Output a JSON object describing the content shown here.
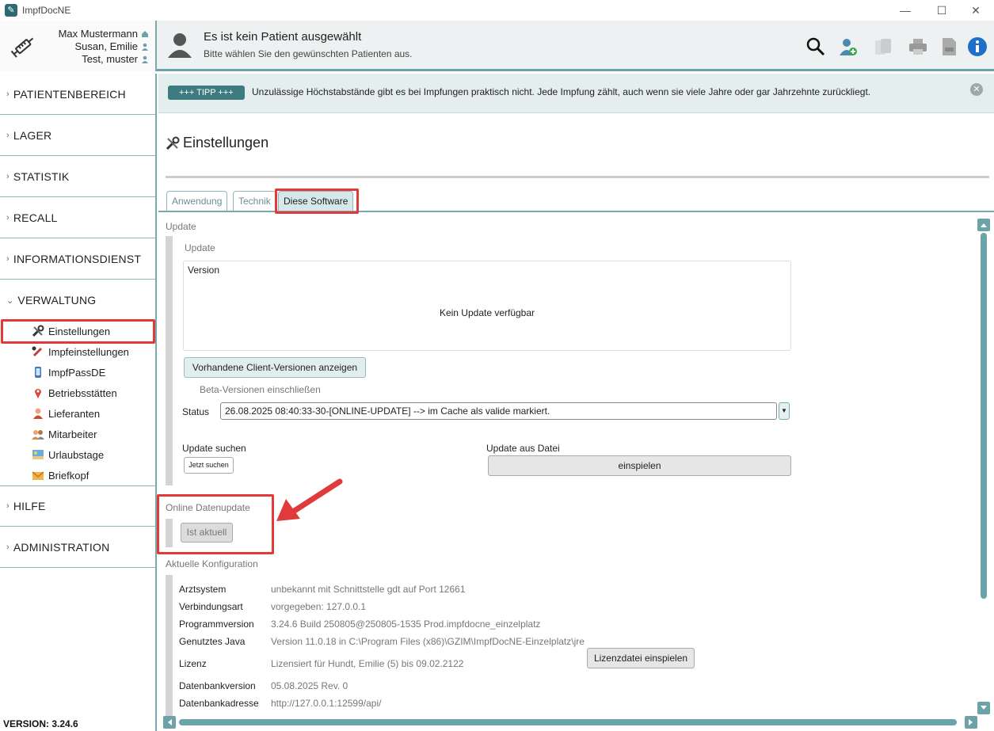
{
  "window": {
    "title": "ImpfDocNE",
    "minimize": "—",
    "maximize": "☐",
    "close": "✕"
  },
  "users": [
    "Max Mustermann",
    "Susan, Emilie",
    "Test, muster"
  ],
  "patient": {
    "title": "Es ist kein Patient ausgewählt",
    "subtitle": "Bitte wählen Sie den gewünschten Patienten aus."
  },
  "header_icons": [
    "search-icon",
    "add-patient-icon",
    "copy-icon",
    "print-icon",
    "export-icon",
    "info-icon"
  ],
  "nav": {
    "sections": [
      "PATIENTENBEREICH",
      "LAGER",
      "STATISTIK",
      "RECALL",
      "INFORMATIONSDIENST",
      "VERWALTUNG"
    ],
    "verwaltung_items": [
      "Einstellungen",
      "Impfeinstellungen",
      "ImpfPassDE",
      "Betriebsstätten",
      "Lieferanten",
      "Mitarbeiter",
      "Urlaubstage",
      "Briefkopf"
    ],
    "bottom_sections": [
      "HILFE",
      "ADMINISTRATION"
    ],
    "chevron": "›",
    "chevron_open": "⌄"
  },
  "version": "VERSION: 3.24.6",
  "tip": {
    "badge": "+++ TIPP +++",
    "text": "Unzulässige Höchstabstände gibt es bei Impfungen praktisch nicht. Jede Impfung zählt, auch wenn sie viele Jahre oder gar Jahrzehnte zurückliegt.",
    "close": "✕"
  },
  "page_title": "Einstellungen",
  "tabs": [
    "Anwendung",
    "Technik",
    "Diese Software"
  ],
  "update": {
    "section": "Update",
    "subsection": "Update",
    "version_label": "Version",
    "no_update": "Kein Update verfügbar",
    "show_versions": "Vorhandene Client-Versionen anzeigen",
    "beta": "Beta-Versionen einschließen",
    "status_label": "Status",
    "status_value": "26.08.2025 08:40:33-30-[ONLINE-UPDATE] --> im Cache als valide markiert.",
    "search_label": "Update suchen",
    "search_button": "Jetzt suchen",
    "file_label": "Update aus Datei",
    "file_button": "einspielen"
  },
  "online": {
    "section": "Online Datenupdate",
    "button": "Ist aktuell"
  },
  "config": {
    "section": "Aktuelle Konfiguration",
    "rows": [
      {
        "label": "Arztsystem",
        "value": "unbekannt mit Schnittstelle gdt auf Port 12661"
      },
      {
        "label": "Verbindungsart",
        "value": "vorgegeben: 127.0.0.1"
      },
      {
        "label": "Programmversion",
        "value": "3.24.6 Build 250805@250805-1535 Prod.impfdocne_einzelplatz"
      },
      {
        "label": "Genutztes Java",
        "value": "Version 11.0.18 in C:\\Program Files (x86)\\GZIM\\ImpfDocNE-Einzelplatz\\jre"
      },
      {
        "label": "Lizenz",
        "value": "Lizensiert für Hundt, Emilie (5) bis 09.02.2122"
      },
      {
        "label": "Datenbankversion",
        "value": "05.08.2025 Rev. 0"
      },
      {
        "label": "Datenbankadresse",
        "value": "http://127.0.0.1:12599/api/"
      }
    ],
    "license_button": "Lizenzdatei einspielen"
  },
  "colors": {
    "accent": "#6ba3a8",
    "highlight": "#e03a3a",
    "tip_badge": "#3d7b80"
  }
}
